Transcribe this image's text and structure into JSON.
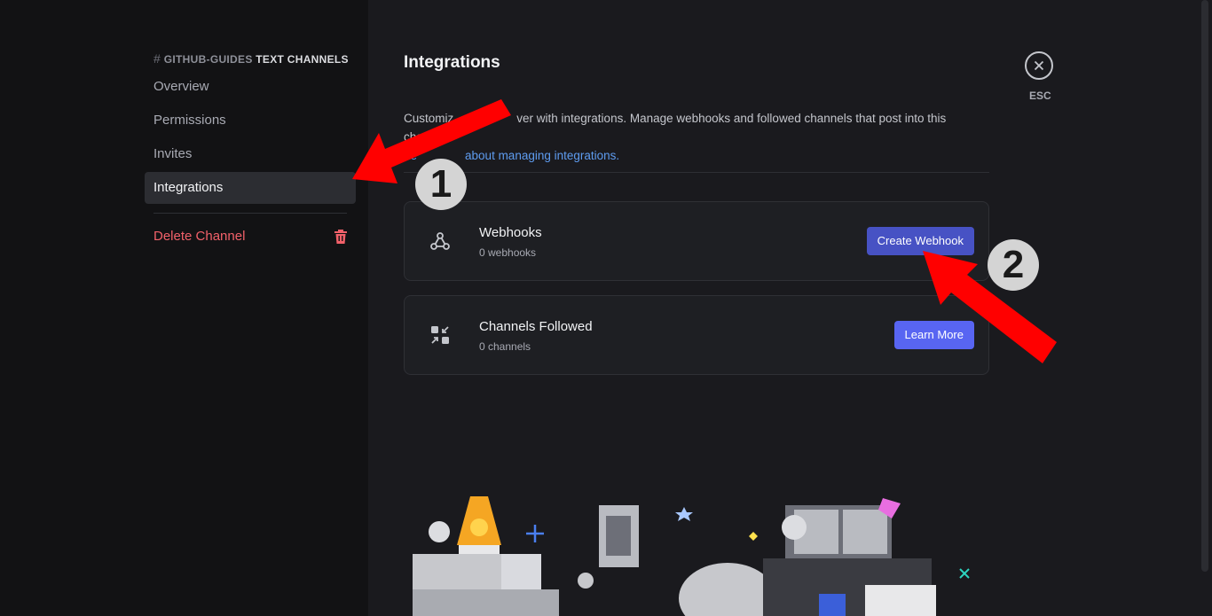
{
  "sidebar": {
    "header_hash": "#",
    "header_channel": "GITHUB-GUIDES",
    "header_category": "TEXT CHANNELS",
    "items": [
      {
        "label": "Overview"
      },
      {
        "label": "Permissions"
      },
      {
        "label": "Invites"
      },
      {
        "label": "Integrations"
      }
    ],
    "delete_label": "Delete Channel"
  },
  "main": {
    "title": "Integrations",
    "description_visible_start": "Customiz",
    "description_visible_end": "ver with integrations. Manage webhooks and followed channels that post into this channel.",
    "link_visible_start": "Le",
    "link_visible_end": "about managing integrations.",
    "cards": [
      {
        "title": "Webhooks",
        "subtitle": "0 webhooks",
        "button": "Create Webhook",
        "icon": "webhook-icon"
      },
      {
        "title": "Channels Followed",
        "subtitle": "0 channels",
        "button": "Learn More",
        "icon": "channels-followed-icon"
      }
    ]
  },
  "close": {
    "label": "ESC"
  },
  "annotations": {
    "badge1": "1",
    "badge2": "2"
  },
  "colors": {
    "accent": "#5865f2",
    "danger": "#f2616a",
    "arrow": "#ff0000"
  }
}
